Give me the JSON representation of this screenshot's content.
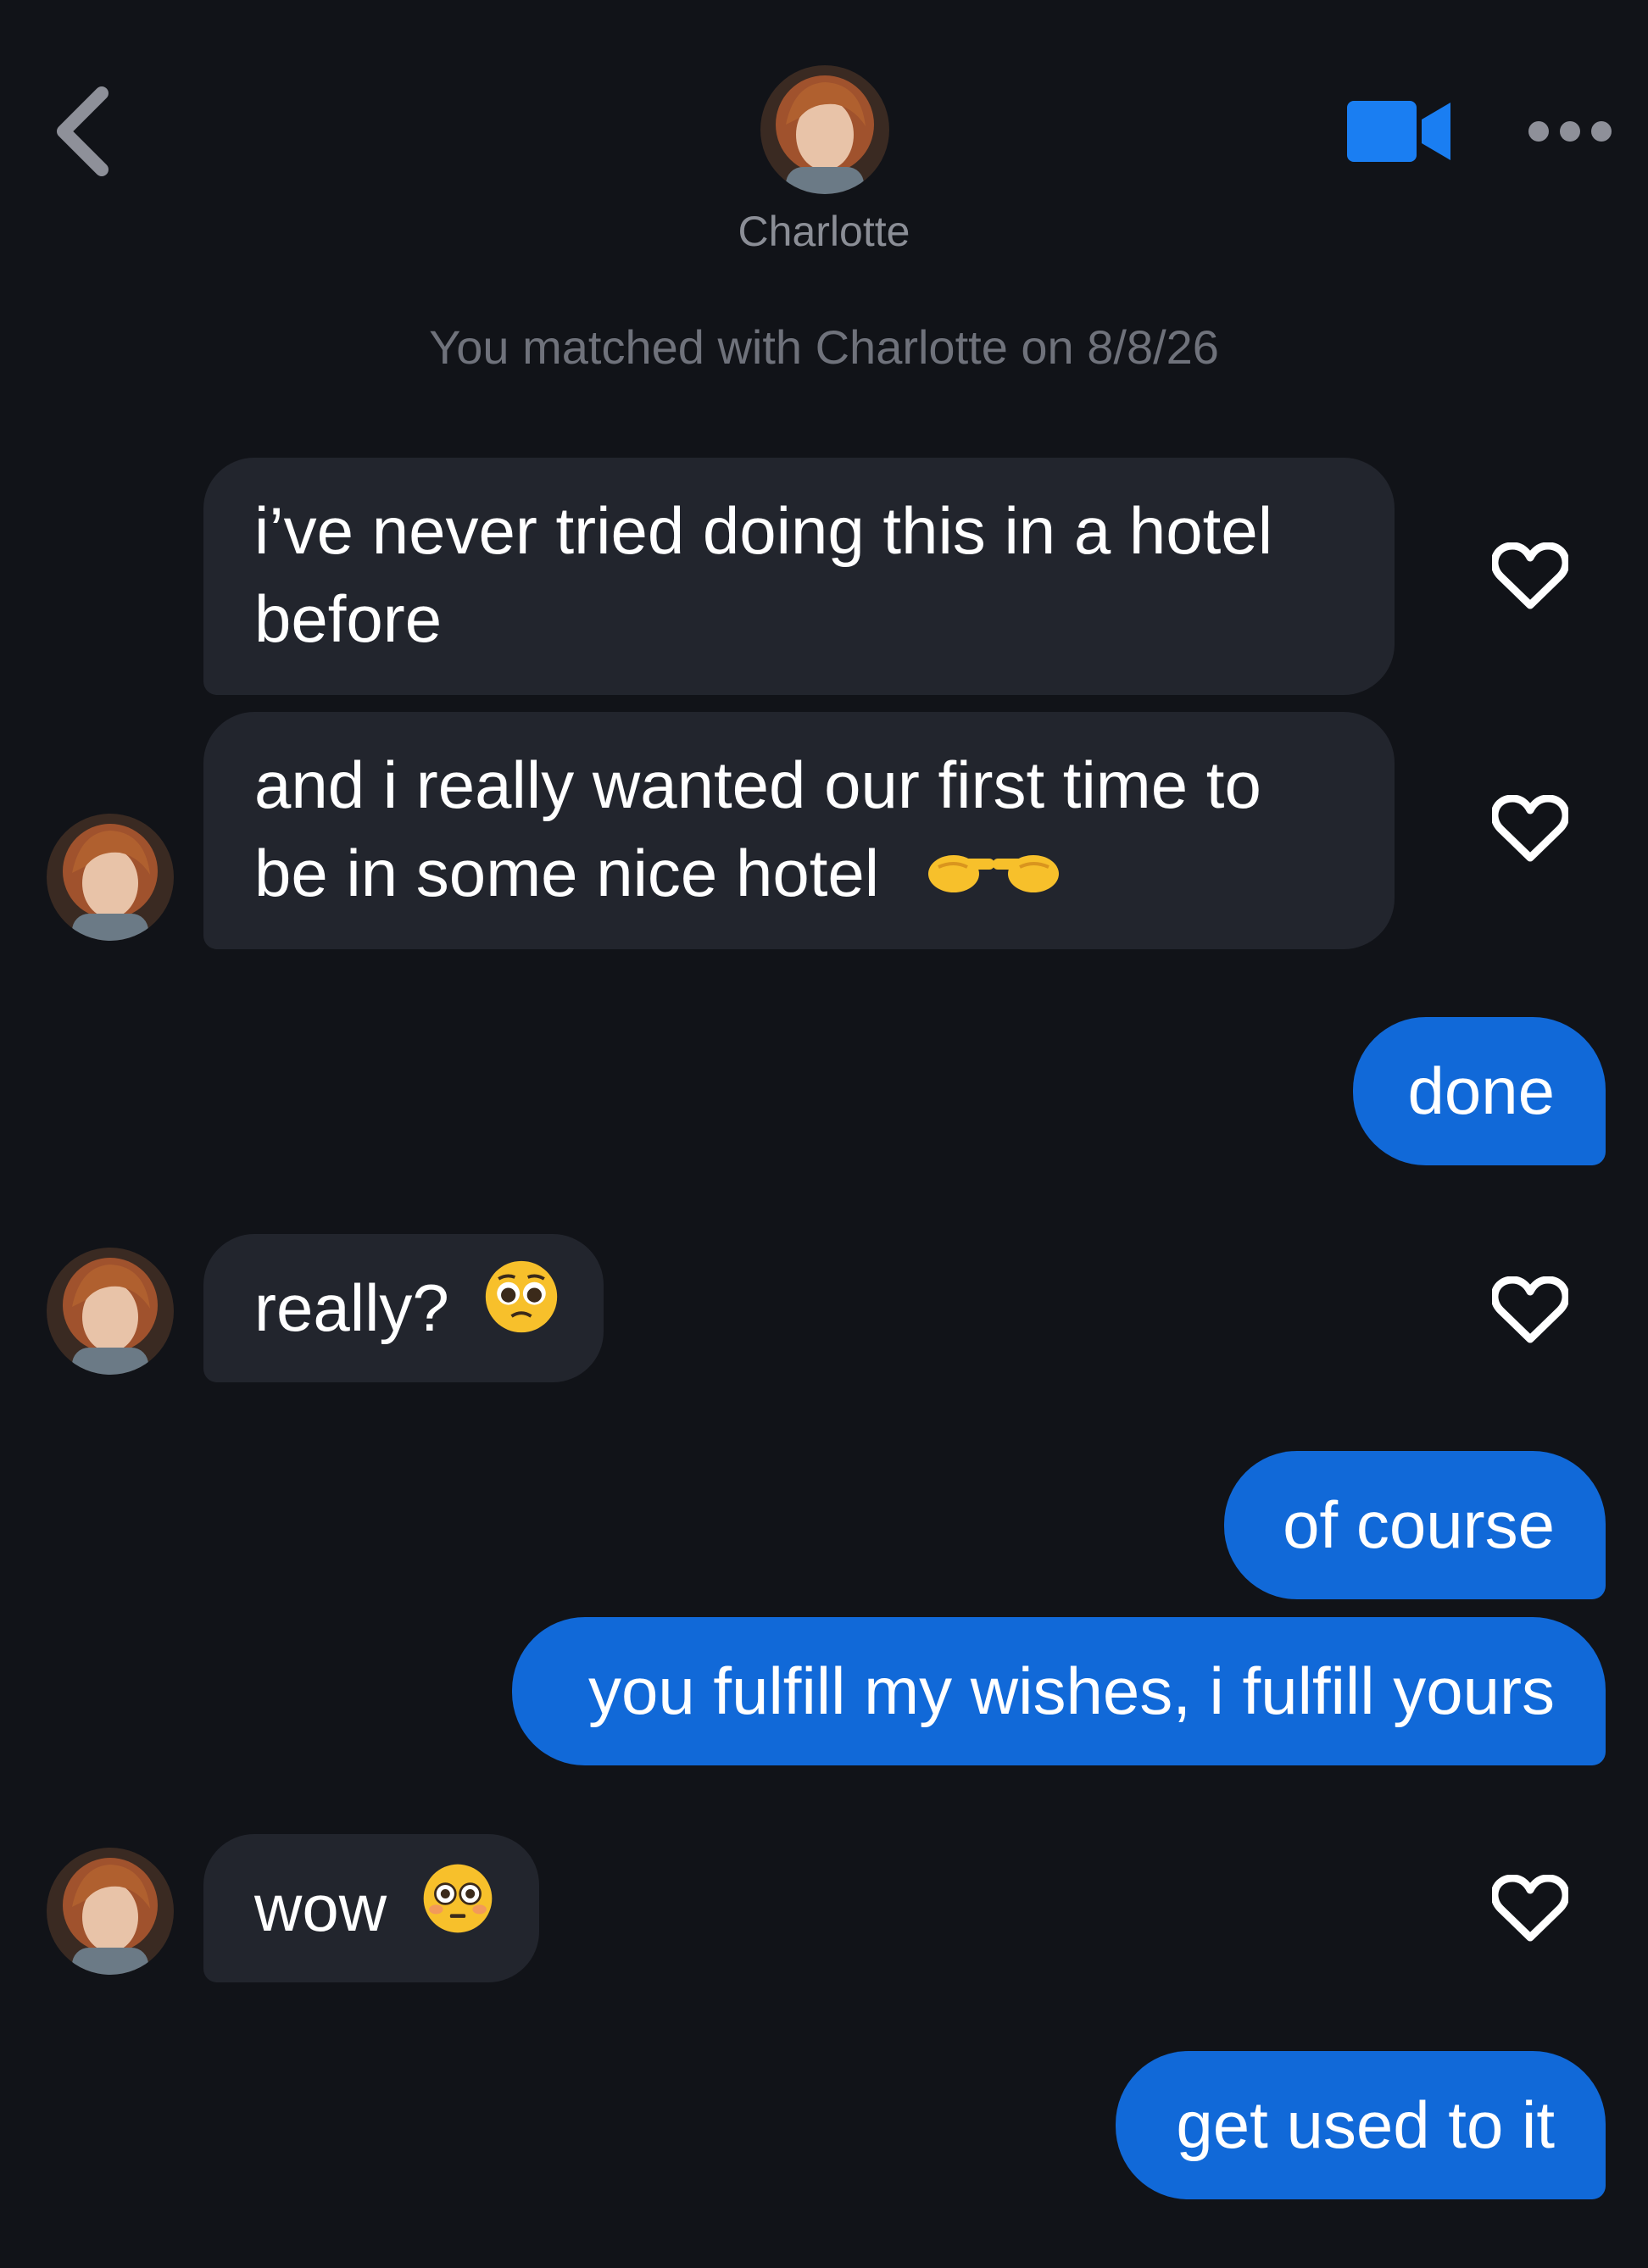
{
  "header": {
    "back_icon": "chevron-left-icon",
    "contact_name": "Charlotte",
    "video_icon": "video-camera-icon",
    "more_icon": "more-horizontal-icon",
    "accent_color": "#1a7ef2"
  },
  "match_notice": "You matched with Charlotte on 8/8/26",
  "messages": [
    {
      "from": "them",
      "lines": [
        "i’ve never tried doing this in a hotel",
        "before"
      ],
      "emoji": ""
    },
    {
      "from": "them",
      "lines": [
        "and i really wanted our first time to",
        "be in some nice hotel"
      ],
      "emoji": "pointing-hands-emoji"
    },
    {
      "from": "me",
      "text": "done"
    },
    {
      "from": "them",
      "lines": [
        "really?"
      ],
      "emoji": "pleading-face-emoji"
    },
    {
      "from": "me",
      "text": "of course"
    },
    {
      "from": "me",
      "text": "you fulfill my wishes, i fulfill yours"
    },
    {
      "from": "them",
      "lines": [
        "wow"
      ],
      "emoji": "flushed-face-emoji"
    },
    {
      "from": "me",
      "text": "get used to it"
    }
  ],
  "colors": {
    "background": "#111318",
    "incoming_bubble": "#22252d",
    "outgoing_bubble": "#1169d8",
    "heart_outline": "#ffffff"
  }
}
